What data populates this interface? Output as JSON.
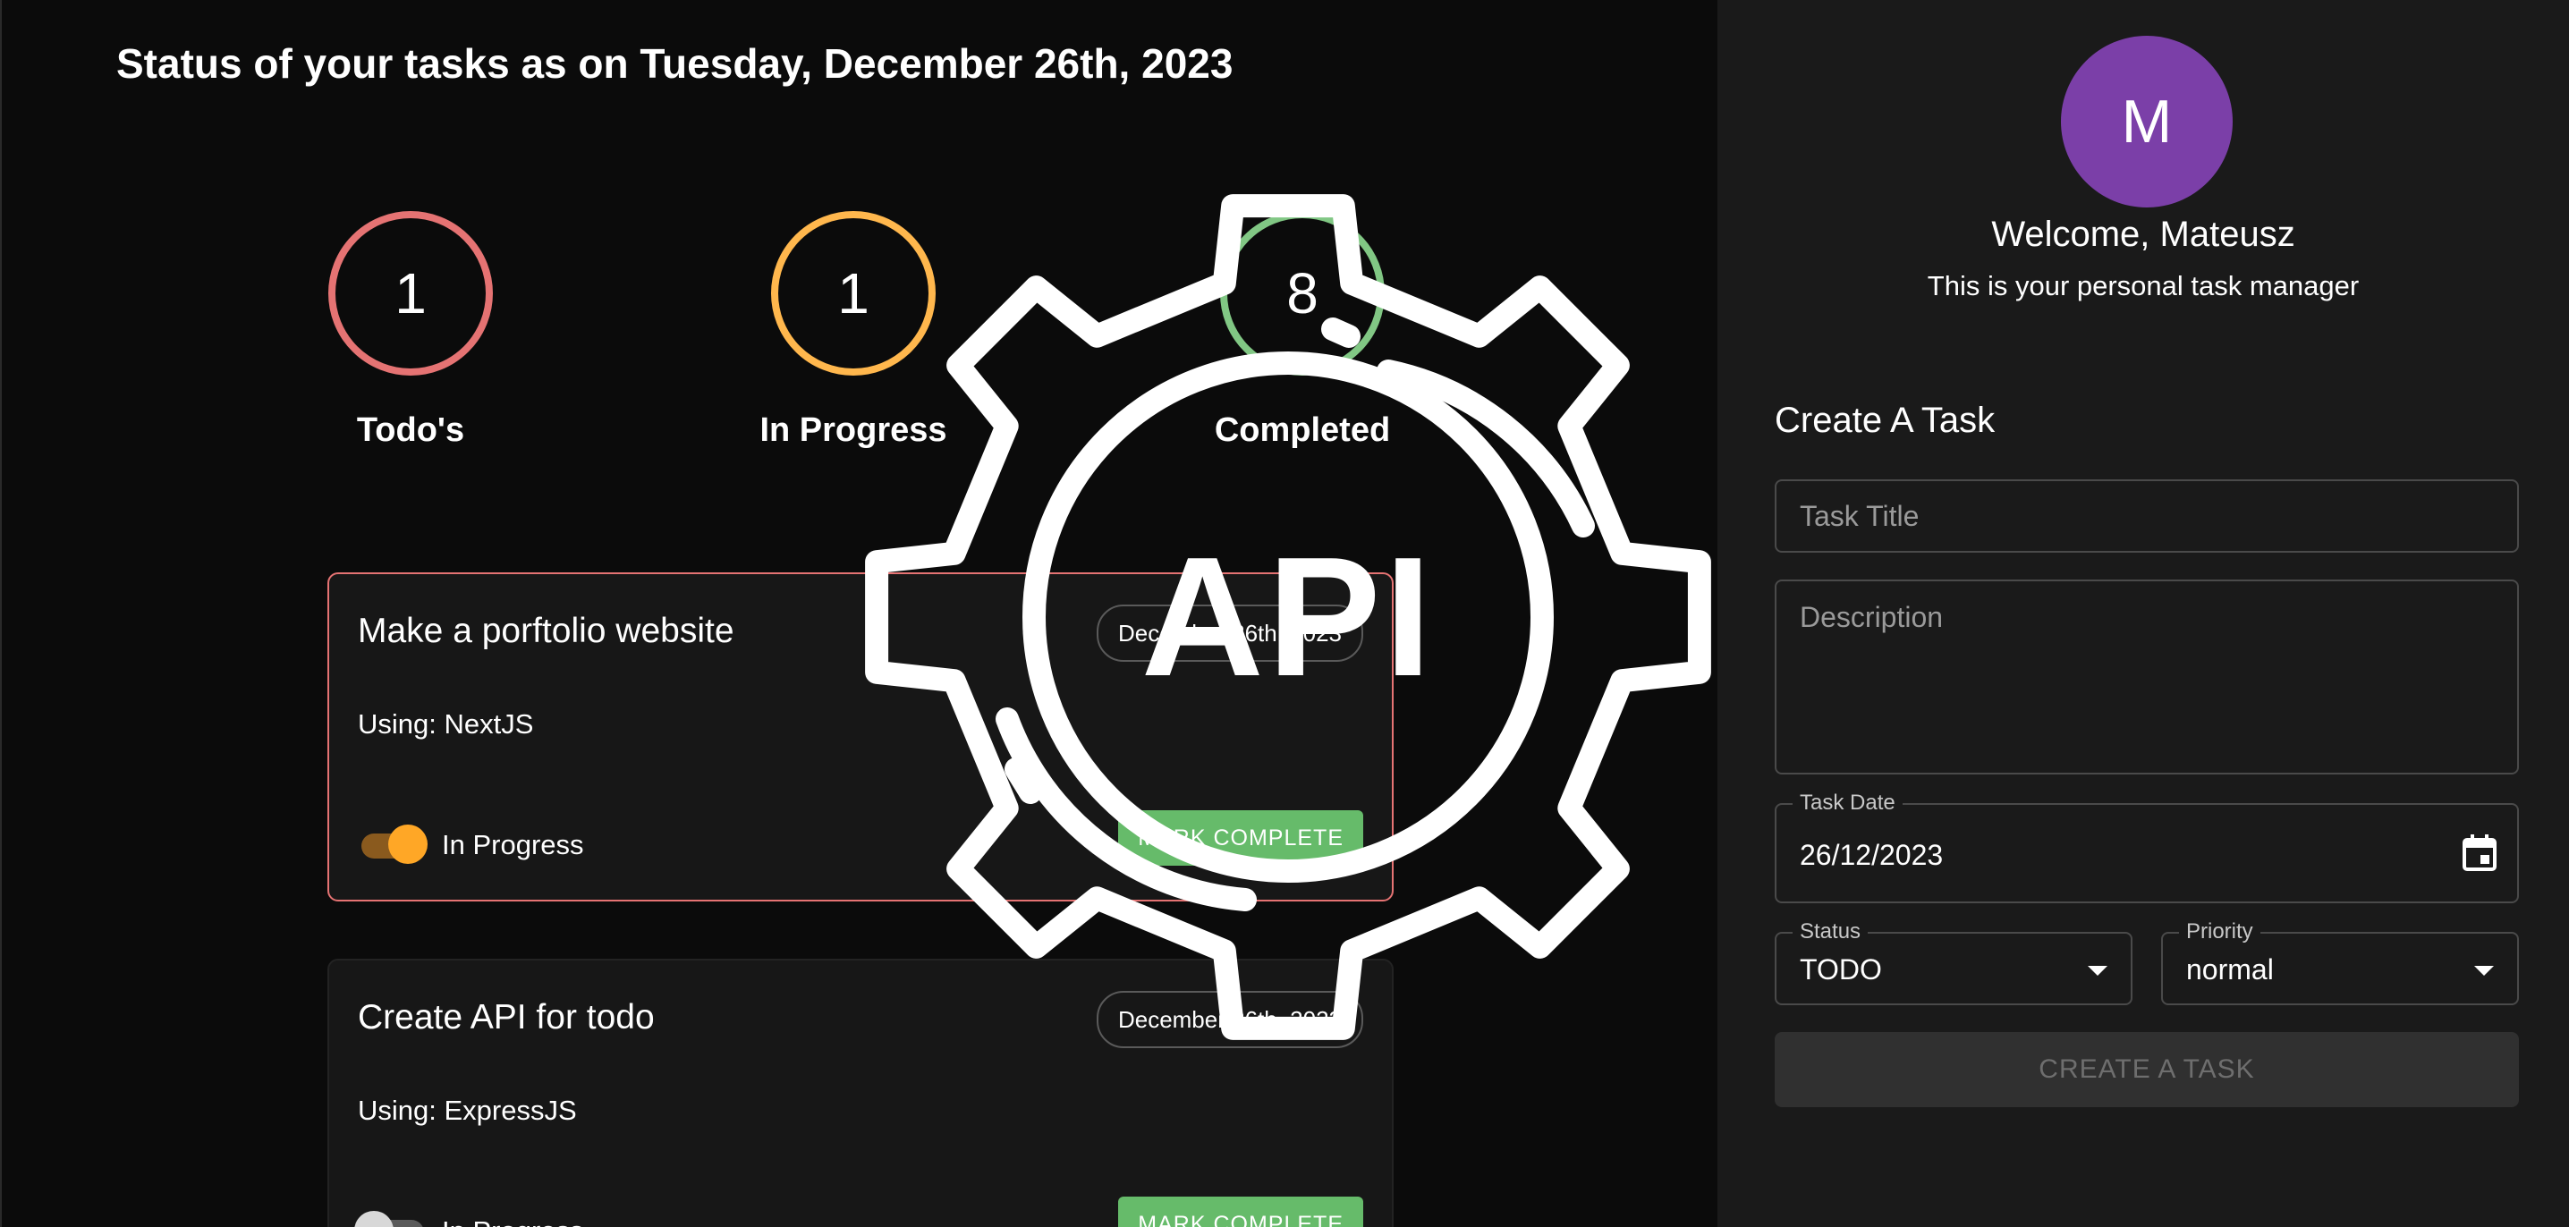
{
  "header": {
    "title": "Status of your tasks as on Tuesday, December 26th, 2023"
  },
  "stats": [
    {
      "count": "1",
      "label": "Todo's",
      "color": "#e57373"
    },
    {
      "count": "1",
      "label": "In Progress",
      "color": "#ffb74d"
    },
    {
      "count": "8",
      "label": "Completed",
      "color": "#81c784"
    }
  ],
  "tasks": [
    {
      "title": "Make a porftolio website",
      "date": "December 26th, 2023",
      "description": "Using: NextJS",
      "status_label": "In Progress",
      "in_progress": true,
      "action_label": "MARK COMPLETE"
    },
    {
      "title": "Create API for todo",
      "date": "December 26th, 2023",
      "description": "Using: ExpressJS",
      "status_label": "In Progress",
      "in_progress": false,
      "action_label": "MARK COMPLETE"
    }
  ],
  "profile": {
    "avatar_letter": "M",
    "welcome": "Welcome, Mateusz",
    "tagline": "This is your personal task manager"
  },
  "form": {
    "section_title": "Create A Task",
    "title_placeholder": "Task Title",
    "description_placeholder": "Description",
    "date_label": "Task Date",
    "date_value": "26/12/2023",
    "status_label": "Status",
    "status_value": "TODO",
    "priority_label": "Priority",
    "priority_value": "normal",
    "submit_label": "CREATE A TASK"
  },
  "overlay": {
    "label": "API",
    "icon": "api-gear-icon"
  },
  "colors": {
    "accent_orange": "#ffa726",
    "complete_green": "#66bb6a",
    "avatar_purple": "#7b3fa8",
    "todo_border": "#e57373"
  }
}
